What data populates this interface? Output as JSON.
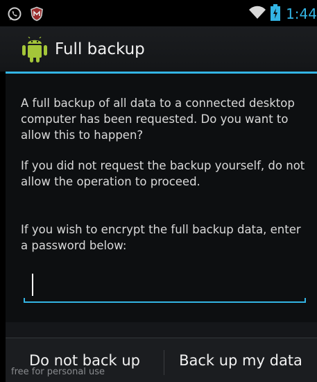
{
  "status_bar": {
    "time": "1:44",
    "left_icons": [
      "whatsapp-icon",
      "mcafee-shield-icon"
    ],
    "right_icons": [
      "wifi-icon",
      "battery-charging-icon"
    ]
  },
  "dialog": {
    "title": "Full backup",
    "title_icon": "android-robot-icon",
    "message_1": "A full backup of all data to a connected desktop computer has been requested. Do you want to allow this to happen?",
    "message_2": "If you did not request the backup yourself, do not allow the operation to proceed.",
    "message_3": "If you wish to encrypt the full backup data, enter a password below:",
    "password": {
      "value": "",
      "placeholder": ""
    },
    "buttons": {
      "deny": "Do not back up",
      "allow": "Back up my data"
    }
  },
  "watermark": "free for personal use",
  "colors": {
    "accent": "#33b5e5",
    "background": "#000000",
    "text": "#dadada"
  }
}
